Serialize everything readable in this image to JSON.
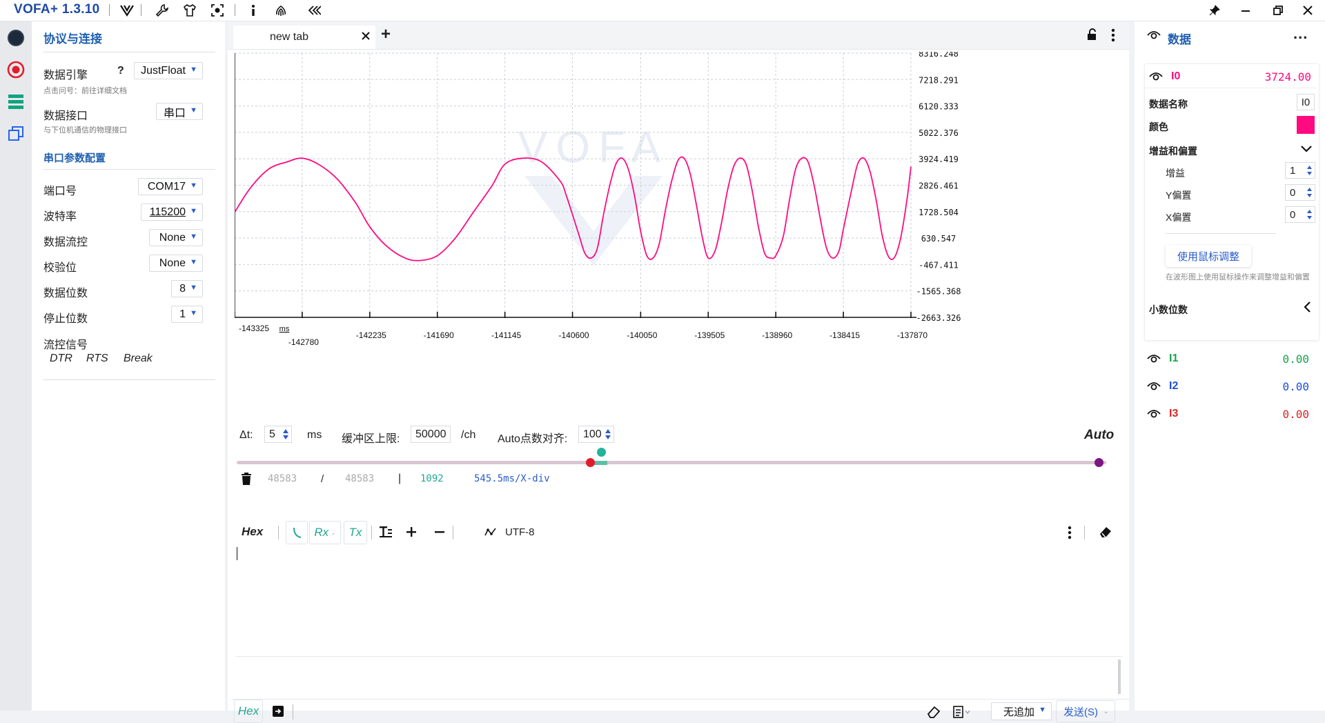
{
  "app": {
    "title": "VOFA+ 1.3.10"
  },
  "left": {
    "section1_title": "协议与连接",
    "engine_label": "数据引擎",
    "engine_help": "?",
    "engine_value": "JustFloat",
    "engine_hint": "点击问号：前往详细文档",
    "interface_label": "数据接口",
    "interface_value": "串口",
    "interface_hint": "与下位机通信的物理接口",
    "section2_title": "串口参数配置",
    "params": [
      {
        "label": "端口号",
        "value": "COM17"
      },
      {
        "label": "波特率",
        "value": "115200"
      },
      {
        "label": "数据流控",
        "value": "None"
      },
      {
        "label": "校验位",
        "value": "None"
      },
      {
        "label": "数据位数",
        "value": "8"
      },
      {
        "label": "停止位数",
        "value": "1"
      }
    ],
    "flow_label": "流控信号",
    "flow_buttons": [
      "DTR",
      "RTS",
      "Break"
    ]
  },
  "tab": {
    "name": "new tab",
    "add": "+"
  },
  "chart_data": {
    "type": "line",
    "title": "",
    "watermark": "VOFA",
    "x_ticks": [
      "-143325",
      "-142780",
      "-142235",
      "-141690",
      "-141145",
      "-140600",
      "-140050",
      "-139505",
      "-138960",
      "-138415",
      "-137870"
    ],
    "x_unit": "ms",
    "xlim": [
      -143325,
      -137870
    ],
    "y_ticks": [
      "8316.248",
      "7218.291",
      "6120.333",
      "5022.376",
      "3924.419",
      "2826.461",
      "1728.504",
      "630.547",
      "-467.411",
      "-1565.368",
      "-2663.326"
    ],
    "ylim": [
      -2663.326,
      8316.248
    ],
    "grid": true,
    "series": [
      {
        "name": "I0",
        "color": "#ff0a80",
        "x": [
          -143325,
          -143200,
          -143050,
          -142900,
          -142780,
          -142650,
          -142500,
          -142350,
          -142235,
          -142100,
          -141950,
          -141830,
          -141690,
          -141550,
          -141400,
          -141250,
          -141145,
          -141000,
          -140850,
          -140700,
          -140650,
          -140550,
          -140500,
          -140450,
          -140400,
          -140350,
          -140300,
          -140250,
          -140200,
          -140150,
          -140100,
          -140050,
          -140000,
          -139950,
          -139900,
          -139850,
          -139800,
          -139750,
          -139700,
          -139650,
          -139600,
          -139550,
          -139505,
          -139450,
          -139400,
          -139350,
          -139300,
          -139250,
          -139200,
          -139150,
          -139100,
          -139050,
          -139000,
          -138960,
          -138900,
          -138850,
          -138800,
          -138750,
          -138700,
          -138650,
          -138600,
          -138550,
          -138500,
          -138450,
          -138415,
          -138350,
          -138300,
          -138250,
          -138200,
          -138150,
          -138100,
          -138050,
          -138000,
          -137950,
          -137900,
          -137870
        ],
        "y": [
          1700,
          2700,
          3500,
          3800,
          3950,
          3700,
          3100,
          2100,
          1100,
          300,
          -200,
          -300,
          -100,
          600,
          1700,
          2800,
          3700,
          3950,
          3800,
          3000,
          2400,
          800,
          0,
          -200,
          200,
          1600,
          2800,
          3700,
          3950,
          3500,
          2400,
          900,
          -100,
          -200,
          400,
          1800,
          3000,
          3850,
          3950,
          3300,
          2000,
          600,
          -200,
          100,
          1200,
          2600,
          3600,
          3950,
          3700,
          2600,
          1100,
          0,
          -200,
          -100,
          700,
          2200,
          3500,
          3950,
          3800,
          2800,
          1400,
          200,
          -200,
          100,
          1000,
          2600,
          3700,
          3950,
          3400,
          2200,
          700,
          -150,
          -150,
          700,
          2300,
          3600
        ]
      }
    ]
  },
  "controls": {
    "dt_label": "Δt:",
    "dt_value": "5",
    "dt_unit": "ms",
    "buffer_label": "缓冲区上限:",
    "buffer_value": "50000",
    "buffer_unit": "/ch",
    "align_label": "Auto点数对齐:",
    "align_value": "100",
    "auto": "Auto",
    "count1": "48583",
    "slash": "/",
    "count2": "48583",
    "bar": "|",
    "count3": "1092",
    "xdiv": "545.5ms/X-div",
    "slider": {
      "left_fraction": 0.406,
      "window_fraction": 0.418
    }
  },
  "console": {
    "hex": "Hex",
    "rx": "Rx",
    "tx": "Tx",
    "encoding": "UTF-8"
  },
  "sendbar": {
    "hex": "Hex",
    "append": "无追加",
    "send": "发送(S)"
  },
  "right": {
    "title": "数据",
    "menu": "...",
    "channels": [
      {
        "name": "I0",
        "value": "3724.00",
        "color": "#ff0a80"
      },
      {
        "name": "I1",
        "value": "0.00",
        "color": "#16a34a"
      },
      {
        "name": "I2",
        "value": "0.00",
        "color": "#1d4ed8"
      },
      {
        "name": "I3",
        "value": "0.00",
        "color": "#dc2626"
      }
    ],
    "name_label": "数据名称",
    "name_value": "I0",
    "color_label": "颜色",
    "color_value": "#ff0a80",
    "gain_section": "增益和偏置",
    "gain_label": "增益",
    "gain_value": "1",
    "yoffset_label": "Y偏置",
    "yoffset_value": "0",
    "xoffset_label": "X偏置",
    "xoffset_value": "0",
    "mouse_btn": "使用鼠标调整",
    "mouse_hint": "在波形图上使用鼠标操作来调整增益和偏置",
    "decimal_label": "小数位数"
  }
}
